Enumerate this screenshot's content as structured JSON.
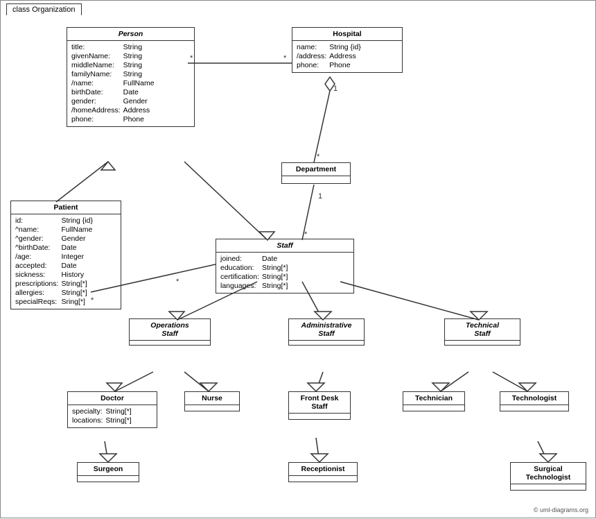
{
  "title": "class Organization",
  "copyright": "© uml-diagrams.org",
  "classes": {
    "person": {
      "name": "Person",
      "italic": true,
      "attributes": [
        [
          "title:",
          "String"
        ],
        [
          "givenName:",
          "String"
        ],
        [
          "middleName:",
          "String"
        ],
        [
          "familyName:",
          "String"
        ],
        [
          "/name:",
          "FullName"
        ],
        [
          "birthDate:",
          "Date"
        ],
        [
          "gender:",
          "Gender"
        ],
        [
          "/homeAddress:",
          "Address"
        ],
        [
          "phone:",
          "Phone"
        ]
      ]
    },
    "hospital": {
      "name": "Hospital",
      "italic": false,
      "attributes": [
        [
          "name:",
          "String {id}"
        ],
        [
          "/address:",
          "Address"
        ],
        [
          "phone:",
          "Phone"
        ]
      ]
    },
    "patient": {
      "name": "Patient",
      "italic": false,
      "attributes": [
        [
          "id:",
          "String {id}"
        ],
        [
          "^name:",
          "FullName"
        ],
        [
          "^gender:",
          "Gender"
        ],
        [
          "^birthDate:",
          "Date"
        ],
        [
          "/age:",
          "Integer"
        ],
        [
          "accepted:",
          "Date"
        ],
        [
          "sickness:",
          "History"
        ],
        [
          "prescriptions:",
          "String[*]"
        ],
        [
          "allergies:",
          "String[*]"
        ],
        [
          "specialReqs:",
          "Sring[*]"
        ]
      ]
    },
    "department": {
      "name": "Department",
      "italic": false,
      "attributes": []
    },
    "staff": {
      "name": "Staff",
      "italic": true,
      "attributes": [
        [
          "joined:",
          "Date"
        ],
        [
          "education:",
          "String[*]"
        ],
        [
          "certification:",
          "String[*]"
        ],
        [
          "languages:",
          "String[*]"
        ]
      ]
    },
    "operationsStaff": {
      "name": "Operations Staff",
      "italic": true,
      "attributes": []
    },
    "administrativeStaff": {
      "name": "Administrative Staff",
      "italic": true,
      "attributes": []
    },
    "technicalStaff": {
      "name": "Technical Staff",
      "italic": true,
      "attributes": []
    },
    "doctor": {
      "name": "Doctor",
      "italic": false,
      "attributes": [
        [
          "specialty:",
          "String[*]"
        ],
        [
          "locations:",
          "String[*]"
        ]
      ]
    },
    "nurse": {
      "name": "Nurse",
      "italic": false,
      "attributes": []
    },
    "frontDeskStaff": {
      "name": "Front Desk Staff",
      "italic": false,
      "attributes": []
    },
    "technician": {
      "name": "Technician",
      "italic": false,
      "attributes": []
    },
    "technologist": {
      "name": "Technologist",
      "italic": false,
      "attributes": []
    },
    "surgeon": {
      "name": "Surgeon",
      "italic": false,
      "attributes": []
    },
    "receptionist": {
      "name": "Receptionist",
      "italic": false,
      "attributes": []
    },
    "surgicalTechnologist": {
      "name": "Surgical Technologist",
      "italic": false,
      "attributes": []
    }
  }
}
